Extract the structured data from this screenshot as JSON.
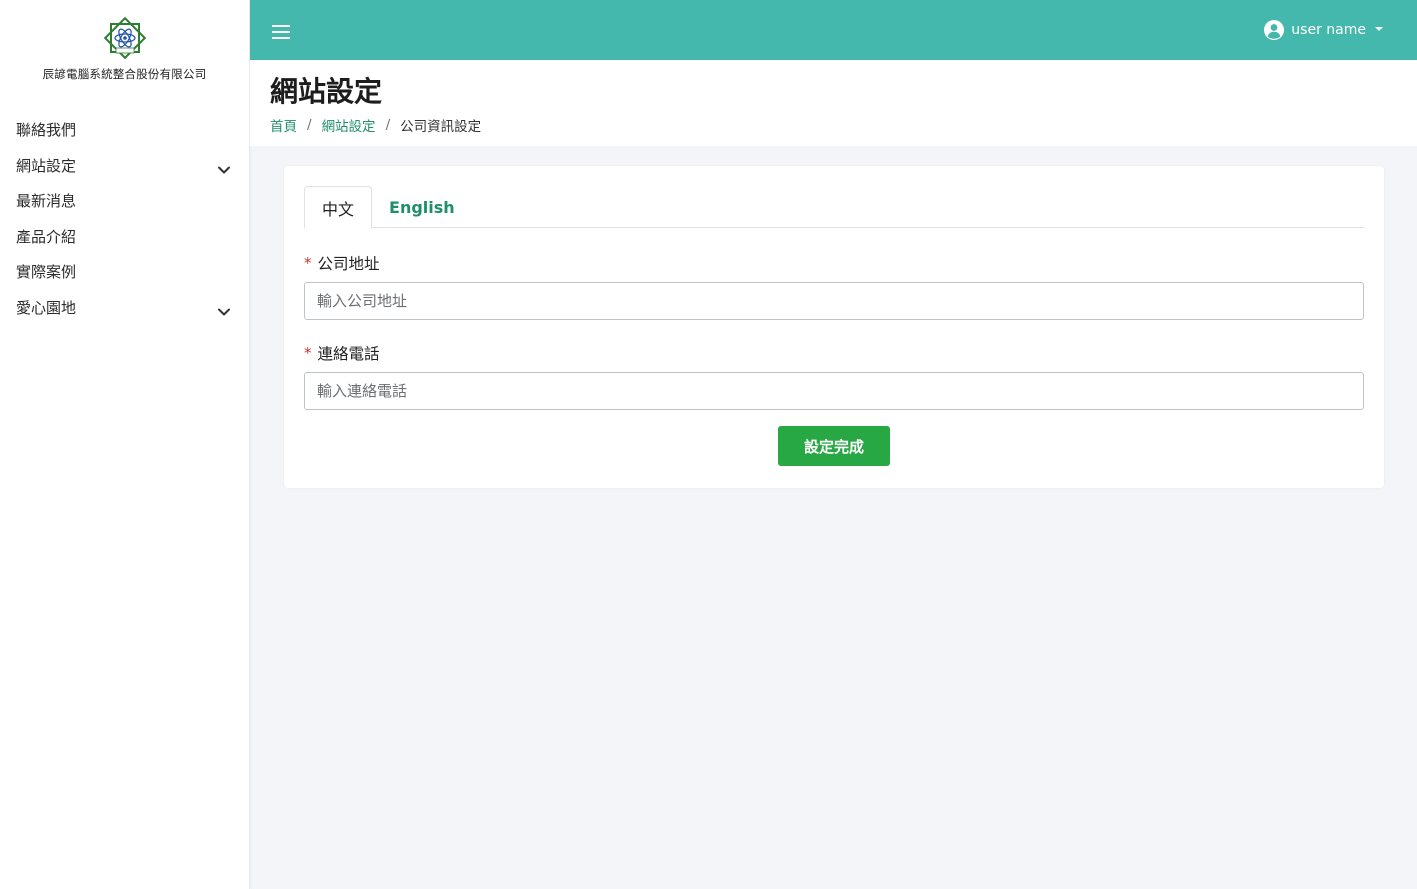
{
  "brand": {
    "name": "辰諺電腦系統整合股份有限公司",
    "logo_icon": "company-logo"
  },
  "sidebar": {
    "items": [
      {
        "label": "聯絡我們",
        "has_submenu": false
      },
      {
        "label": "網站設定",
        "has_submenu": true
      },
      {
        "label": "最新消息",
        "has_submenu": false
      },
      {
        "label": "產品介紹",
        "has_submenu": false
      },
      {
        "label": "實際案例",
        "has_submenu": false
      },
      {
        "label": "愛心園地",
        "has_submenu": true
      }
    ]
  },
  "topbar": {
    "user_name": "user name",
    "background": "#45b8ad"
  },
  "page": {
    "title": "網站設定",
    "breadcrumb": {
      "home": "首頁",
      "section": "網站設定",
      "current": "公司資訊設定",
      "separator": "/"
    }
  },
  "form": {
    "tabs": [
      {
        "label": "中文",
        "active": true
      },
      {
        "label": "English",
        "active": false
      }
    ],
    "fields": [
      {
        "required_mark": "*",
        "label": "公司地址",
        "placeholder": "輸入公司地址",
        "value": ""
      },
      {
        "required_mark": "*",
        "label": "連絡電話",
        "placeholder": "輸入連絡電話",
        "value": ""
      }
    ],
    "submit_label": "設定完成"
  },
  "colors": {
    "accent": "#45b8ad",
    "link": "#1f8f6a",
    "button": "#28a745",
    "required": "#c0392b"
  }
}
